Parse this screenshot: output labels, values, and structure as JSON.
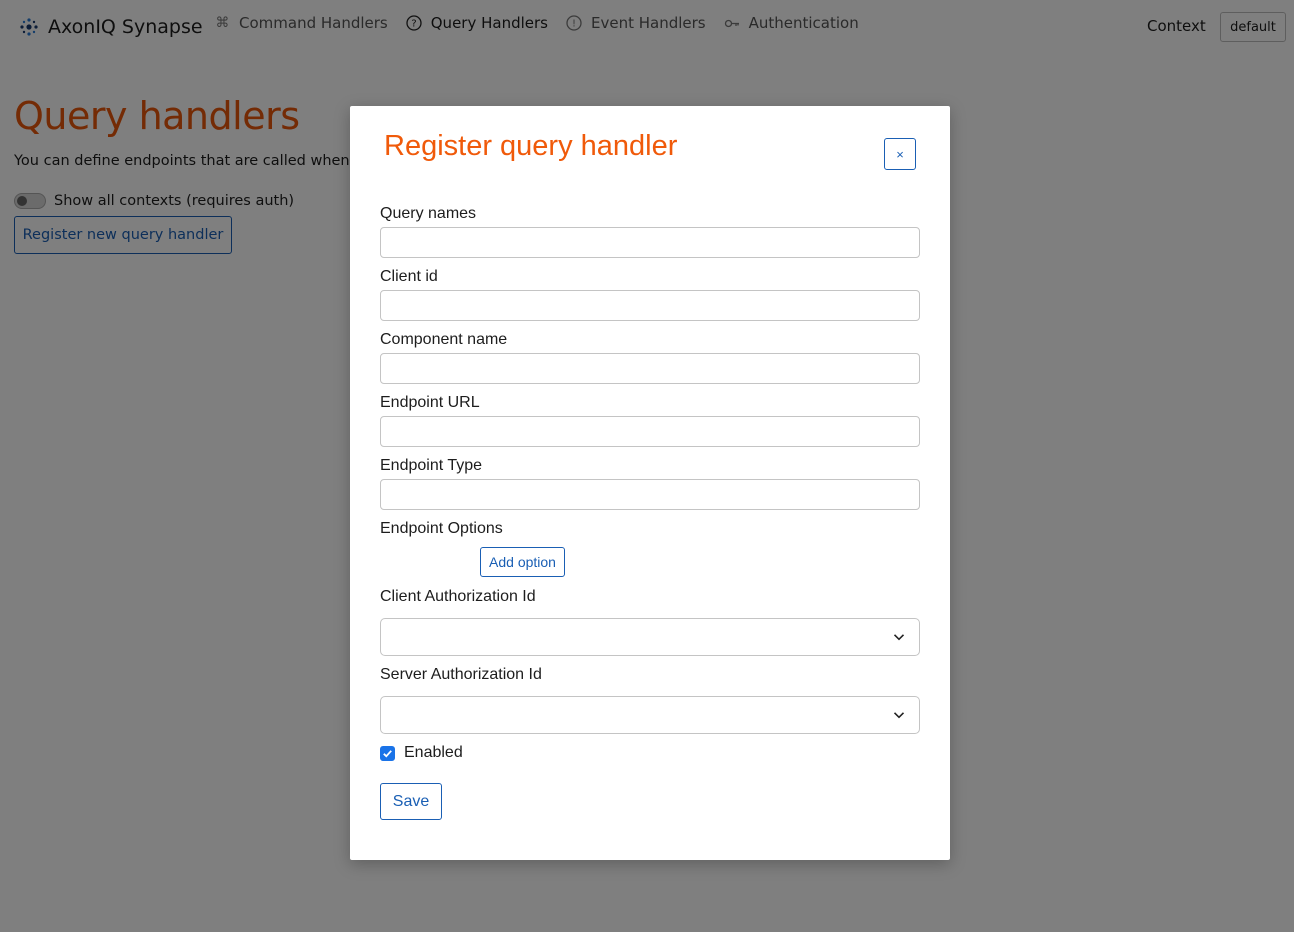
{
  "brand": {
    "name": "AxonIQ Synapse",
    "icon": "axoniq-logo-icon"
  },
  "nav": {
    "items": [
      {
        "label": "Command Handlers",
        "icon": "command-icon",
        "active": false
      },
      {
        "label": "Query Handlers",
        "icon": "question-circle-icon",
        "active": true
      },
      {
        "label": "Event Handlers",
        "icon": "exclamation-circle-icon",
        "active": false
      },
      {
        "label": "Authentication",
        "icon": "key-icon",
        "active": false
      }
    ],
    "context_label": "Context",
    "context_value": "default"
  },
  "background": {
    "title": "Query handlers",
    "description": "You can define endpoints that are called when a q",
    "toggle_label": "Show all contexts (requires auth)",
    "toggle_on": false,
    "register_button": "Register new query handler"
  },
  "modal": {
    "title": "Register query handler",
    "close_label": "×",
    "fields": {
      "query_names": {
        "label": "Query names",
        "value": ""
      },
      "client_id": {
        "label": "Client id",
        "value": ""
      },
      "component_name": {
        "label": "Component name",
        "value": ""
      },
      "endpoint_url": {
        "label": "Endpoint URL",
        "value": ""
      },
      "endpoint_type": {
        "label": "Endpoint Type",
        "value": ""
      },
      "endpoint_options": {
        "label": "Endpoint Options",
        "add_label": "Add option"
      },
      "client_auth": {
        "label": "Client Authorization Id",
        "value": ""
      },
      "server_auth": {
        "label": "Server Authorization Id",
        "value": ""
      },
      "enabled": {
        "label": "Enabled",
        "checked": true
      }
    },
    "save_label": "Save"
  },
  "colors": {
    "accent_orange": "#f05a0a",
    "link_blue": "#1a5fb4",
    "checkbox_blue": "#1a73e8",
    "overlay": "rgba(0,0,0,0.5)"
  }
}
